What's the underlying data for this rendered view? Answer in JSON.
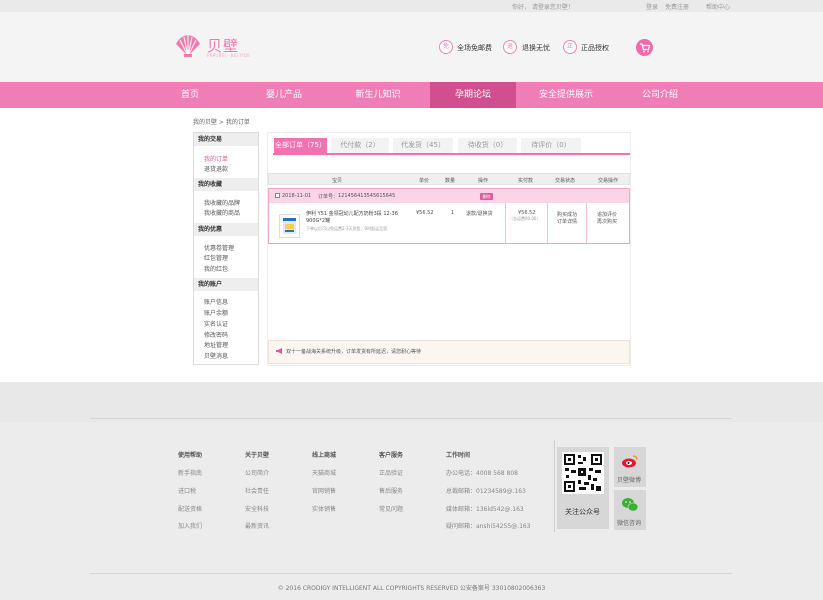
{
  "topbar": {
    "greeting": "你好，   请登录您贝壁！",
    "login": "登录",
    "register": "免费注册",
    "help": "帮助中心"
  },
  "brand": {
    "name": "贝壁",
    "tagline": "FRPUBEI · BEI YIDE"
  },
  "features": [
    {
      "icon": "shipping-icon",
      "glyph": "免",
      "label": "全场免邮费"
    },
    {
      "icon": "return-icon",
      "glyph": "退",
      "label": "退换无忧"
    },
    {
      "icon": "authentic-icon",
      "glyph": "正",
      "label": "正品授权"
    }
  ],
  "nav": [
    "首页",
    "婴儿产品",
    "新生儿知识",
    "孕期论坛",
    "安全提供展示",
    "公司介绍"
  ],
  "nav_active_index": 3,
  "breadcrumb": "我的贝壁 > 我的订单",
  "sidebar": [
    {
      "title": "我的交易",
      "items": [
        "我的订单",
        "退货退款"
      ]
    },
    {
      "title": "我的收藏",
      "items": [
        "我收藏的品牌",
        "我收藏的商品"
      ]
    },
    {
      "title": "我的优惠",
      "items": [
        "优惠卷管理",
        "红包管理",
        "我的红包"
      ]
    },
    {
      "title": "我的账户",
      "items": [
        "账户信息",
        "账户余额",
        "实名认证",
        "修改密码",
        "地址管理",
        "贝壁消息"
      ]
    }
  ],
  "tabs": [
    "全部订单（75）",
    "代付款（2）",
    "代发货（45）",
    "待收货（0）",
    "待评价（0）"
  ],
  "table": {
    "headers": [
      "宝贝",
      "单价",
      "数量",
      "操作",
      "实付款",
      "交易状态",
      "交易操作"
    ]
  },
  "order": {
    "date": "2018-11-01",
    "order_no_label": "订单号：",
    "order_no": "121456413545615645",
    "delete_label": "删除",
    "product_name": "伊利 Y51 金领冠幼儿配方奶粉3段 12-36 900G*2罐",
    "product_sub": "下单以后可以免运费2-3天到货，0时起运至您",
    "price": "¥56.52",
    "qty": "1",
    "operation": "退款/退换货",
    "paid": "¥56.52",
    "paid_note": "（含运费00.00）",
    "status_1": "购买成功",
    "status_2": "订单详情",
    "action_1": "追加评价",
    "action_2": "再次购买"
  },
  "notice": "双十一备战海关系统升级，订单发货有所延迟，请您耐心等待",
  "footer": {
    "columns": [
      {
        "title": "使用帮助",
        "items": [
          "新手指南",
          "进口税",
          "配送资格",
          "加入我们"
        ]
      },
      {
        "title": "关于贝壁",
        "items": [
          "公司简介",
          "社会责任",
          "安全科技",
          "最新资讯"
        ]
      },
      {
        "title": "线上商城",
        "items": [
          "天猫商城",
          "官网销售",
          "实体销售"
        ]
      },
      {
        "title": "客户服务",
        "items": [
          "正品验证",
          "售后服务",
          "常见问题"
        ]
      },
      {
        "title": "工作时间",
        "items": [
          "办公电话：4008 568 808",
          "总裁邮箱：01234589@.163",
          "媒体邮箱：136ld542@.163",
          "疑问邮箱：anshi54255@.163"
        ]
      }
    ],
    "qr_label": "关注公众号",
    "weibo_label": "贝壁微博",
    "wechat_label": "微信咨询",
    "copyright": "©  2016  CRODIGY INTELLIGENT ALL COPYRIGHTS RESERVED     公安备案号 33010802006363"
  },
  "colors": {
    "brand_pink": "#ef7eb7",
    "nav_active": "#d14f8e",
    "accent": "#e4559b"
  }
}
